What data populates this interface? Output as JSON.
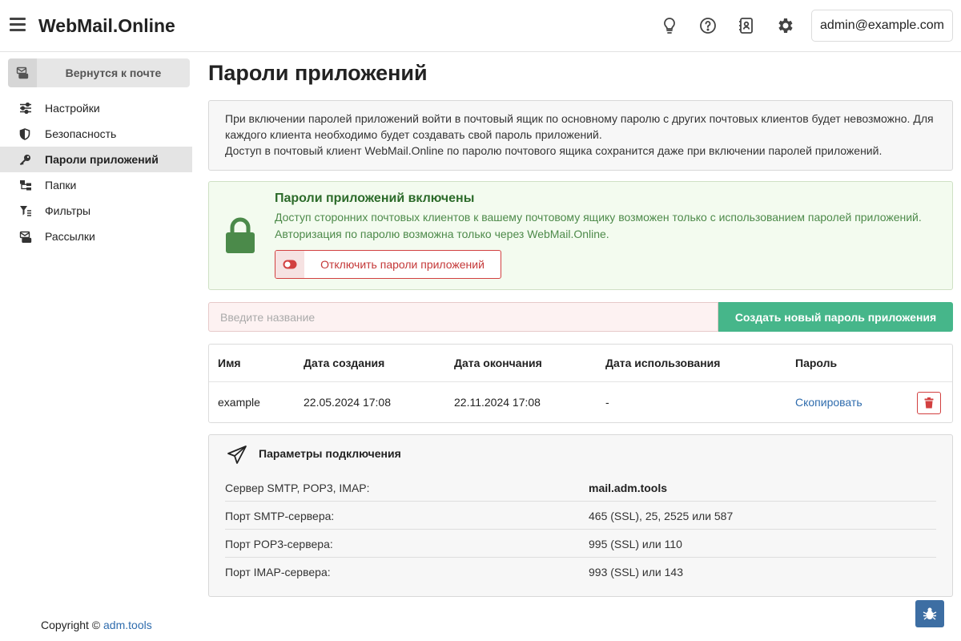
{
  "header": {
    "brand": "WebMail.Online",
    "user": "admin@example.com",
    "icons": [
      "menu-icon",
      "lightbulb-icon",
      "help-icon",
      "contacts-icon",
      "gear-icon"
    ]
  },
  "sidebar": {
    "back_label": "Вернутся к почте",
    "items": [
      {
        "label": "Настройки",
        "icon": "sliders-icon"
      },
      {
        "label": "Безопасность",
        "icon": "shield-icon"
      },
      {
        "label": "Пароли приложений",
        "icon": "key-icon",
        "active": true
      },
      {
        "label": "Папки",
        "icon": "folders-icon"
      },
      {
        "label": "Фильтры",
        "icon": "filter-icon"
      },
      {
        "label": "Рассылки",
        "icon": "mailings-icon"
      }
    ],
    "footer_prefix": "Copyright © ",
    "footer_link": "adm.tools"
  },
  "main": {
    "title": "Пароли приложений",
    "info": [
      "При включении паролей приложений войти в почтовый ящик по основному паролю с других почтовых клиентов будет невозможно. Для каждого клиента необходимо будет создавать свой пароль приложений.",
      "Доступ в почтовый клиент WebMail.Online по паролю почтового ящика сохранится даже при включении паролей приложений."
    ],
    "status": {
      "title": "Пароли приложений включены",
      "line1": "Доступ сторонних почтовых клиентов к вашему почтовому ящику возможен только с использованием паролей приложений.",
      "line2": "Авторизация по паролю возможна только через WebMail.Online.",
      "disable_label": "Отключить пароли приложений"
    },
    "create": {
      "placeholder": "Введите название",
      "value": "",
      "button": "Создать новый пароль приложения"
    },
    "table": {
      "columns": [
        "Имя",
        "Дата создания",
        "Дата окончания",
        "Дата использования",
        "Пароль"
      ],
      "rows": [
        {
          "name": "example",
          "created": "22.05.2024 17:08",
          "expires": "22.11.2024 17:08",
          "used": "-",
          "password": "Скопировать"
        }
      ]
    },
    "connection": {
      "title": "Параметры подключения",
      "rows": [
        {
          "key": "Сервер SMTP, POP3, IMAP:",
          "value": "mail.adm.tools"
        },
        {
          "key": "Порт SMTP-сервера:",
          "value": "465 (SSL), 25, 2525 или 587"
        },
        {
          "key": "Порт POP3-сервера:",
          "value": "995 (SSL) или 110"
        },
        {
          "key": "Порт IMAP-сервера:",
          "value": "993 (SSL) или 143"
        }
      ]
    }
  },
  "colors": {
    "accent_green": "#46b68a",
    "success_text": "#2c6b2a",
    "danger": "#d24040",
    "link": "#2f6cad",
    "bug_button": "#3d6ea3"
  }
}
